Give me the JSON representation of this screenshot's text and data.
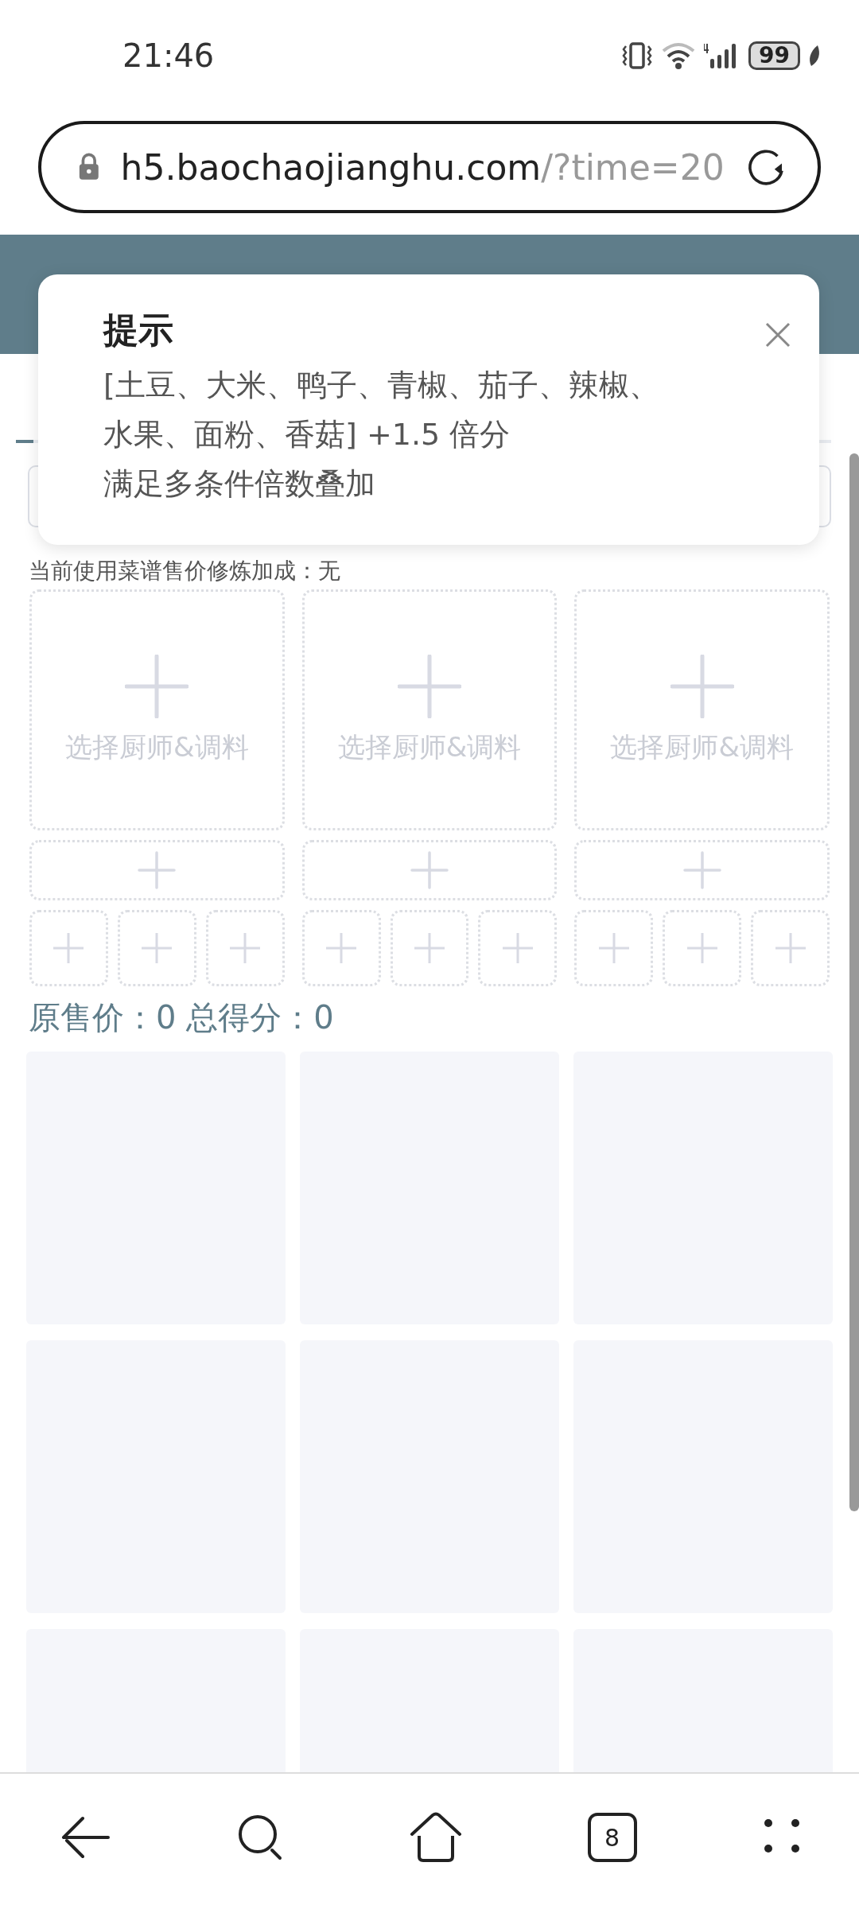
{
  "status_bar": {
    "time": "21:46",
    "battery": "99"
  },
  "address_bar": {
    "host": "h5.baochaojianghu.com",
    "path": "/?time=20"
  },
  "bonus_note": "当前使用菜谱售价修炼加成：无",
  "chef_slots": [
    {
      "label": "选择厨师&调料"
    },
    {
      "label": "选择厨师&调料"
    },
    {
      "label": "选择厨师&调料"
    }
  ],
  "summary": "原售价：0 总得分：0",
  "dialog": {
    "title": "提示",
    "lines": [
      "[土豆、大米、鸭子、青椒、茄子、辣椒、水果、面粉、香菇] +1.5 倍分",
      "满足多条件倍数叠加"
    ]
  },
  "bottom_nav": {
    "tab_count": "8"
  }
}
